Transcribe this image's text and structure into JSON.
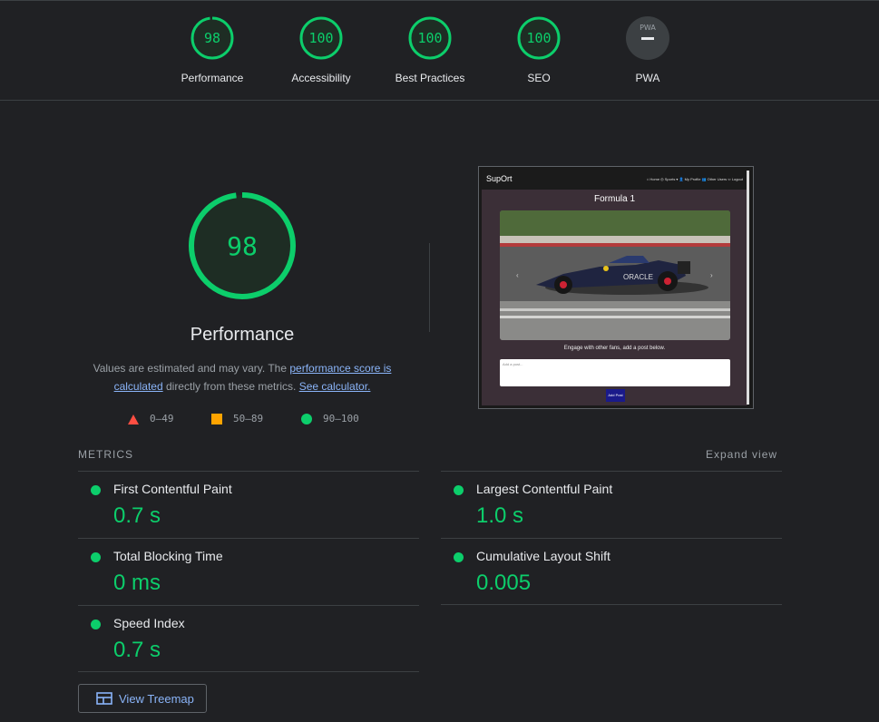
{
  "gauges": [
    {
      "score": "98",
      "label": "Performance",
      "color": "#0cce6b",
      "fraction": 0.98
    },
    {
      "score": "100",
      "label": "Accessibility",
      "color": "#0cce6b",
      "fraction": 1.0
    },
    {
      "score": "100",
      "label": "Best Practices",
      "color": "#0cce6b",
      "fraction": 1.0
    },
    {
      "score": "100",
      "label": "SEO",
      "color": "#0cce6b",
      "fraction": 1.0
    },
    {
      "label": "PWA",
      "badge": "PWA",
      "color": "#5f6368"
    }
  ],
  "main": {
    "score": "98",
    "fraction": 0.98,
    "title": "Performance",
    "desc_part1": "Values are estimated and may vary. The ",
    "desc_link1": "performance score is calculated",
    "desc_part2": " directly from these metrics. ",
    "desc_link2": "See calculator.",
    "legend": [
      {
        "range": "0–49",
        "shape": "triangle",
        "color": "#ff4e42"
      },
      {
        "range": "50–89",
        "shape": "square",
        "color": "#ffa400"
      },
      {
        "range": "90–100",
        "shape": "circle",
        "color": "#0cce6b"
      }
    ]
  },
  "screenshot": {
    "brand": "SupOrt",
    "nav_links": "⌂ Home  ◎ Sports ▾  👤 My Profile  👥 Other Users  ⇦ Logout",
    "heading": "Formula 1",
    "caption": "Engage with other fans, add a post below.",
    "input_placeholder": "Add a post...",
    "button_label": "Add Post",
    "car_text": "ORACLE"
  },
  "metrics": {
    "heading": "METRICS",
    "expand_label": "Expand view",
    "items": [
      {
        "name": "First Contentful Paint",
        "value": "0.7 s"
      },
      {
        "name": "Largest Contentful Paint",
        "value": "1.0 s"
      },
      {
        "name": "Total Blocking Time",
        "value": "0 ms"
      },
      {
        "name": "Cumulative Layout Shift",
        "value": "0.005"
      },
      {
        "name": "Speed Index",
        "value": "0.7 s"
      }
    ]
  },
  "treemap_label": "View Treemap"
}
